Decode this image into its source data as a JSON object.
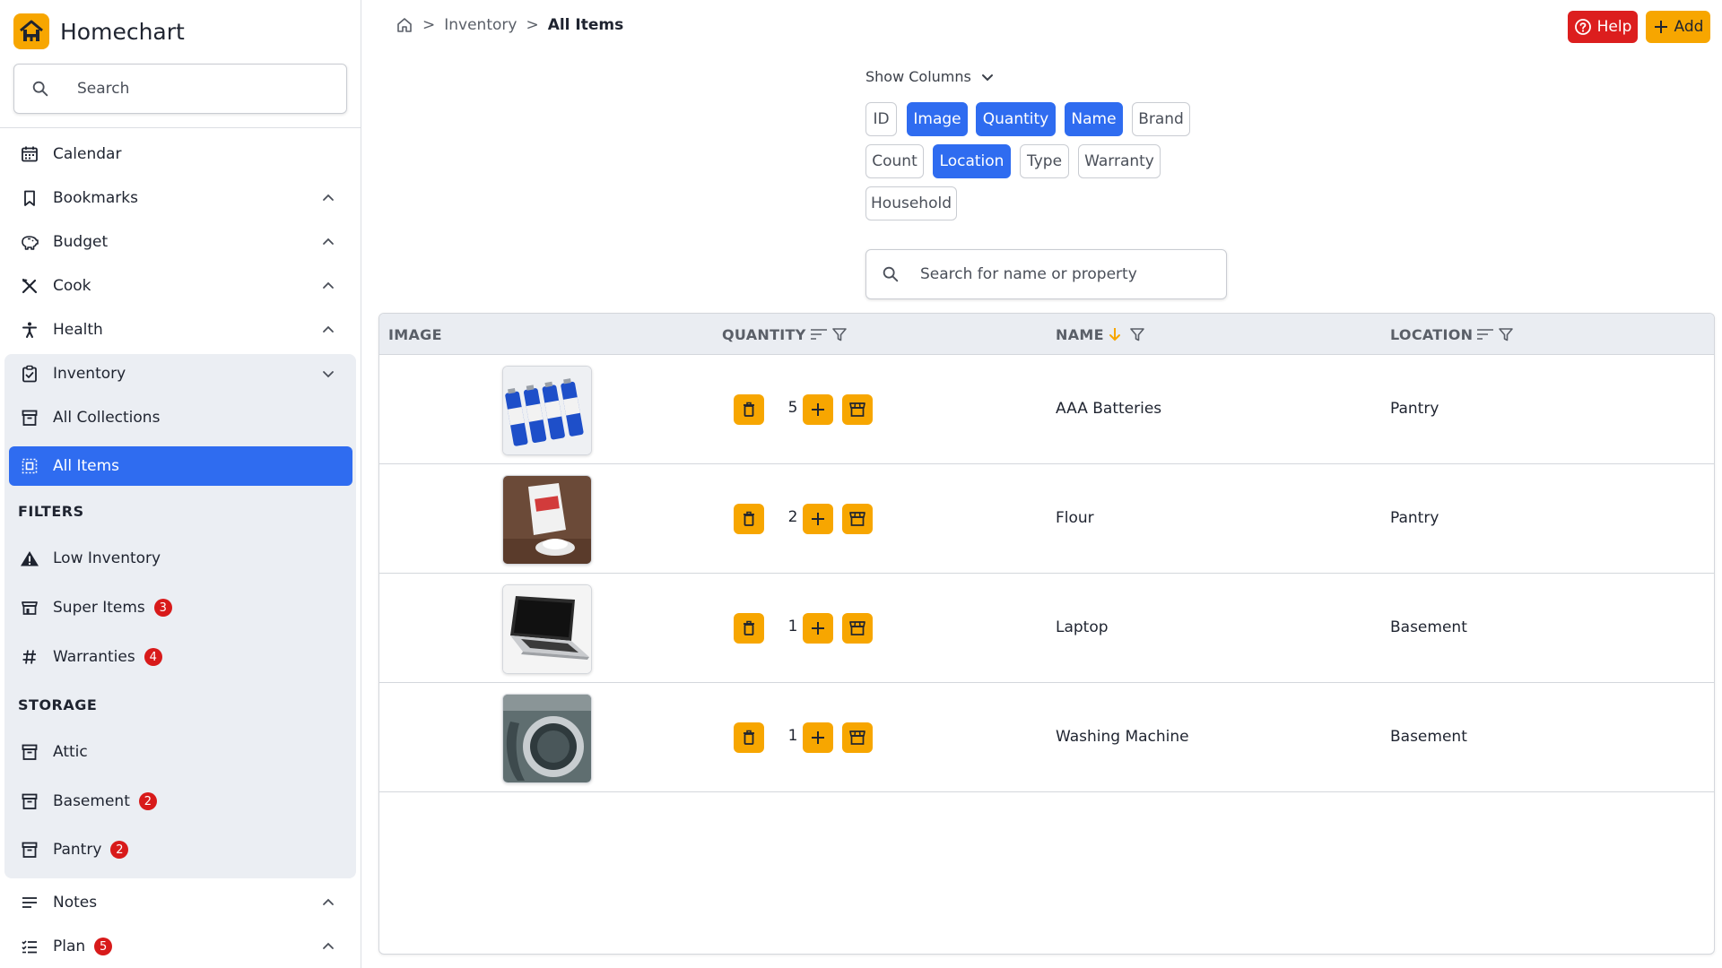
{
  "app": {
    "name": "Homechart"
  },
  "sidebar": {
    "search_placeholder": "Search",
    "top_items": [
      {
        "label": "Calendar",
        "icon": "calendar-icon"
      },
      {
        "label": "Bookmarks",
        "icon": "bookmark-icon"
      },
      {
        "label": "Budget",
        "icon": "piggy-bank-icon"
      },
      {
        "label": "Cook",
        "icon": "utensils-icon"
      },
      {
        "label": "Health",
        "icon": "person-icon"
      },
      {
        "label": "Inventory",
        "icon": "clipboard-icon"
      }
    ],
    "inventory": {
      "all_collections": "All Collections",
      "all_items": "All Items",
      "filters_label": "FILTERS",
      "filters": [
        {
          "label": "Low Inventory",
          "icon": "warning-icon",
          "badge": ""
        },
        {
          "label": "Super Items",
          "icon": "store-icon",
          "badge": "3"
        },
        {
          "label": "Warranties",
          "icon": "hash-icon",
          "badge": "4"
        }
      ],
      "storage_label": "STORAGE",
      "storage": [
        {
          "label": "Attic",
          "icon": "archive-icon",
          "badge": ""
        },
        {
          "label": "Basement",
          "icon": "archive-icon",
          "badge": "2"
        },
        {
          "label": "Pantry",
          "icon": "archive-icon",
          "badge": "2"
        }
      ]
    },
    "bottom_items": [
      {
        "label": "Notes",
        "icon": "notes-icon",
        "badge": ""
      },
      {
        "label": "Plan",
        "icon": "checklist-icon",
        "badge": "5"
      }
    ]
  },
  "header": {
    "breadcrumb": [
      "Inventory",
      "All Items"
    ],
    "help_label": "Help",
    "add_label": "Add"
  },
  "columns_panel": {
    "toggle_label": "Show Columns",
    "chips": [
      {
        "label": "ID",
        "on": false
      },
      {
        "label": "Image",
        "on": true
      },
      {
        "label": "Quantity",
        "on": true
      },
      {
        "label": "Name",
        "on": true
      },
      {
        "label": "Brand",
        "on": false
      },
      {
        "label": "Count",
        "on": false
      },
      {
        "label": "Location",
        "on": true
      },
      {
        "label": "Type",
        "on": false
      },
      {
        "label": "Warranty",
        "on": false
      },
      {
        "label": "Household",
        "on": false
      }
    ]
  },
  "search": {
    "placeholder": "Search for name or property"
  },
  "table": {
    "headers": {
      "image": "IMAGE",
      "quantity": "QUANTITY",
      "name": "NAME",
      "location": "LOCATION"
    },
    "rows": [
      {
        "image": "batteries",
        "quantity": "5",
        "name": "AAA Batteries",
        "location": "Pantry"
      },
      {
        "image": "flour",
        "quantity": "2",
        "name": "Flour",
        "location": "Pantry"
      },
      {
        "image": "laptop",
        "quantity": "1",
        "name": "Laptop",
        "location": "Basement"
      },
      {
        "image": "washing-machine",
        "quantity": "1",
        "name": "Washing Machine",
        "location": "Basement"
      }
    ]
  },
  "colors": {
    "accent": "#2f6cf0",
    "brand": "#f7a600",
    "danger": "#dc1e1e",
    "badge": "#d81a1a"
  }
}
